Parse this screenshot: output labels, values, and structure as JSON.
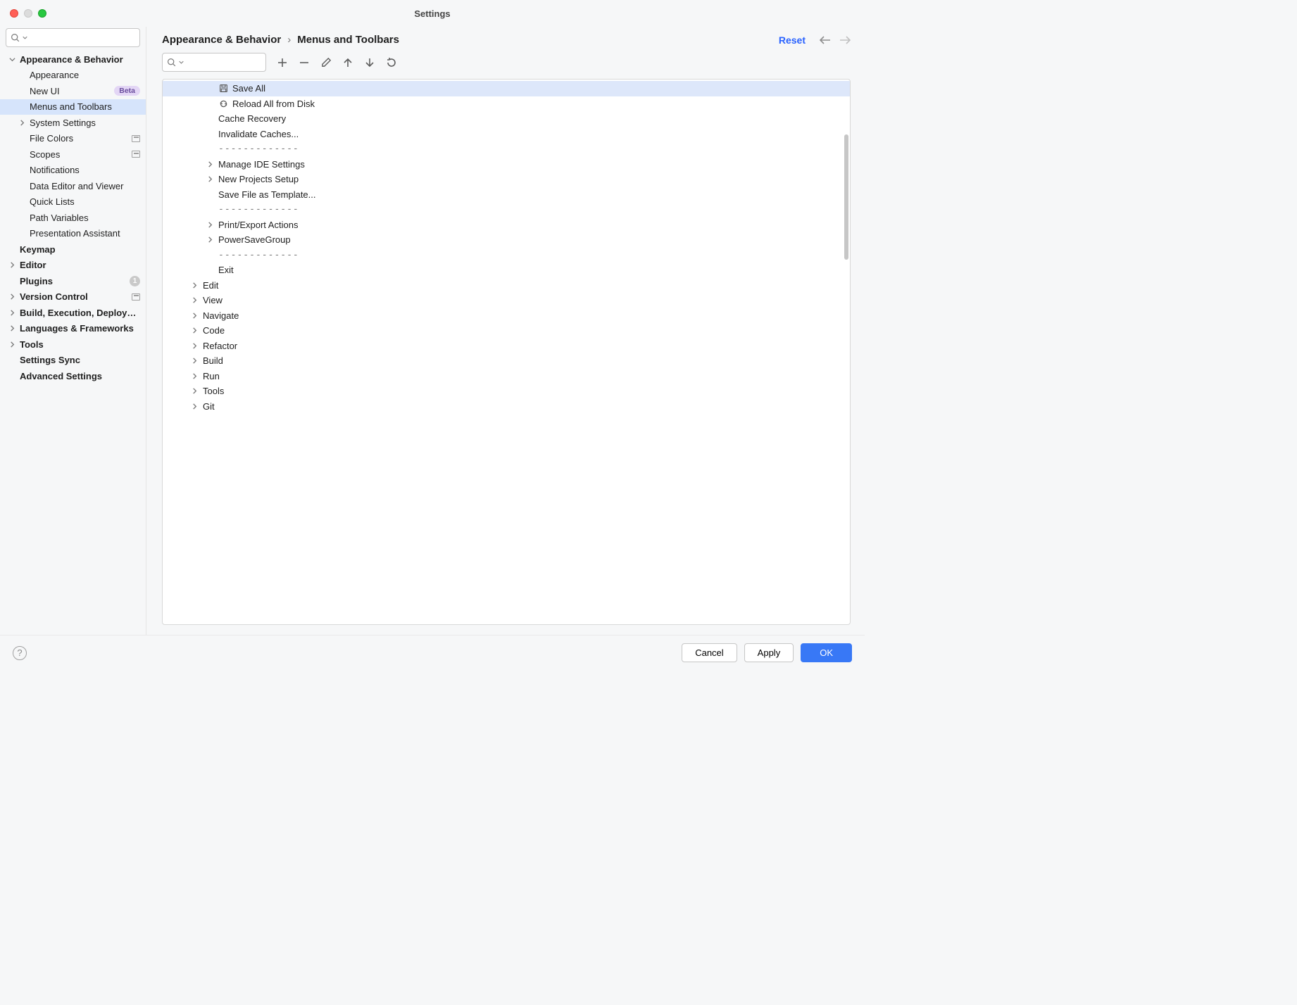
{
  "window": {
    "title": "Settings"
  },
  "sidebar": {
    "search_placeholder": "",
    "items": [
      {
        "label": "Appearance & Behavior",
        "top": true,
        "expandable": true,
        "expanded": true,
        "indent": 0
      },
      {
        "label": "Appearance",
        "indent": 1
      },
      {
        "label": "New UI",
        "indent": 1,
        "badge": "Beta"
      },
      {
        "label": "Menus and Toolbars",
        "indent": 1,
        "selected": true
      },
      {
        "label": "System Settings",
        "indent": 1,
        "expandable": true
      },
      {
        "label": "File Colors",
        "indent": 1,
        "project_icon": true
      },
      {
        "label": "Scopes",
        "indent": 1,
        "project_icon": true
      },
      {
        "label": "Notifications",
        "indent": 1
      },
      {
        "label": "Data Editor and Viewer",
        "indent": 1
      },
      {
        "label": "Quick Lists",
        "indent": 1
      },
      {
        "label": "Path Variables",
        "indent": 1
      },
      {
        "label": "Presentation Assistant",
        "indent": 1
      },
      {
        "label": "Keymap",
        "top": true,
        "indent": 0
      },
      {
        "label": "Editor",
        "top": true,
        "expandable": true,
        "indent": 0
      },
      {
        "label": "Plugins",
        "top": true,
        "indent": 0,
        "count": "1"
      },
      {
        "label": "Version Control",
        "top": true,
        "expandable": true,
        "indent": 0,
        "project_icon": true
      },
      {
        "label": "Build, Execution, Deployment",
        "top": true,
        "expandable": true,
        "indent": 0
      },
      {
        "label": "Languages & Frameworks",
        "top": true,
        "expandable": true,
        "indent": 0
      },
      {
        "label": "Tools",
        "top": true,
        "expandable": true,
        "indent": 0
      },
      {
        "label": "Settings Sync",
        "top": true,
        "indent": 0
      },
      {
        "label": "Advanced Settings",
        "top": true,
        "indent": 0
      }
    ]
  },
  "main": {
    "breadcrumb": [
      "Appearance & Behavior",
      "Menus and Toolbars"
    ],
    "reset_label": "Reset",
    "search_placeholder": "",
    "separator_label": "-------------",
    "tree": [
      {
        "label": "Save All",
        "indent": 2,
        "icon": "save-icon",
        "selected": true
      },
      {
        "label": "Reload All from Disk",
        "indent": 2,
        "icon": "reload-icon"
      },
      {
        "label": "Cache Recovery",
        "indent": 2
      },
      {
        "label": "Invalidate Caches...",
        "indent": 2
      },
      {
        "separator": true,
        "indent": 2
      },
      {
        "label": "Manage IDE Settings",
        "indent": 2,
        "expandable": true
      },
      {
        "label": "New Projects Setup",
        "indent": 2,
        "expandable": true
      },
      {
        "label": "Save File as Template...",
        "indent": 2
      },
      {
        "separator": true,
        "indent": 2
      },
      {
        "label": "Print/Export Actions",
        "indent": 2,
        "expandable": true
      },
      {
        "label": "PowerSaveGroup",
        "indent": 2,
        "expandable": true
      },
      {
        "separator": true,
        "indent": 2
      },
      {
        "label": "Exit",
        "indent": 2
      },
      {
        "label": "Edit",
        "indent": 1,
        "expandable": true
      },
      {
        "label": "View",
        "indent": 1,
        "expandable": true
      },
      {
        "label": "Navigate",
        "indent": 1,
        "expandable": true
      },
      {
        "label": "Code",
        "indent": 1,
        "expandable": true
      },
      {
        "label": "Refactor",
        "indent": 1,
        "expandable": true
      },
      {
        "label": "Build",
        "indent": 1,
        "expandable": true
      },
      {
        "label": "Run",
        "indent": 1,
        "expandable": true
      },
      {
        "label": "Tools",
        "indent": 1,
        "expandable": true
      },
      {
        "label": "Git",
        "indent": 1,
        "expandable": true
      }
    ]
  },
  "footer": {
    "cancel": "Cancel",
    "apply": "Apply",
    "ok": "OK"
  }
}
